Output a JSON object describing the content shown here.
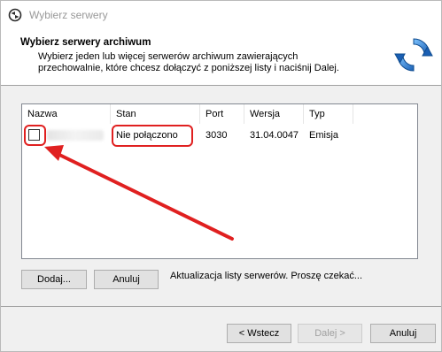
{
  "window": {
    "title": "Wybierz serwery"
  },
  "header": {
    "title": "Wybierz serwery archiwum",
    "description": "Wybierz jeden lub więcej serwerów archiwum zawierających przechowalnie, które chcesz dołączyć z poniższej listy i naciśnij Dalej."
  },
  "table": {
    "columns": [
      "Nazwa",
      "Stan",
      "Port",
      "Wersja",
      "Typ"
    ],
    "rows": [
      {
        "name": "",
        "state": "Nie połączono",
        "port": "3030",
        "version": "31.04.0047",
        "type": "Emisja",
        "checked": false
      }
    ]
  },
  "list_buttons": {
    "add": "Dodaj...",
    "cancel": "Anuluj"
  },
  "status_text": "Aktualizacja listy serwerów. Proszę czekać...",
  "footer": {
    "back": "< Wstecz",
    "next": "Dalej >",
    "cancel": "Anuluj"
  },
  "colors": {
    "highlight": "#e02020",
    "accent": "#1e73d2"
  },
  "icons": {
    "title": "refresh-icon",
    "wizard": "sync-arrows-icon"
  }
}
